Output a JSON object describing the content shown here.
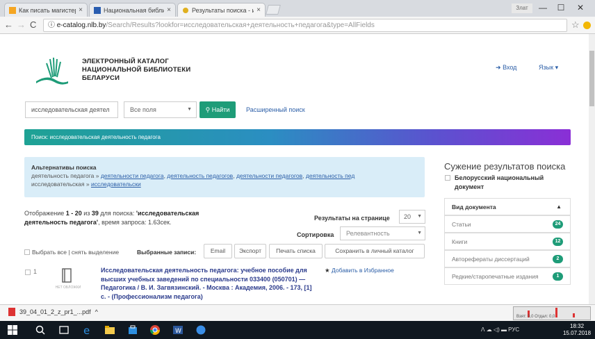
{
  "browser": {
    "tabs": [
      {
        "label": "Как писать магистерс",
        "close": "×"
      },
      {
        "label": "Национальная библиот",
        "close": "×"
      },
      {
        "label": "Результаты поиска - ис",
        "close": "×"
      }
    ],
    "user_label": "Злат",
    "window_controls": {
      "minimize": "—",
      "maximize": "☐",
      "close": "✕"
    },
    "nav": {
      "back": "←",
      "forward": "→",
      "reload": "C",
      "info": "ⓘ"
    },
    "url_host": "e-catalog.nlb.by",
    "url_path": "/Search/Results?lookfor=исследовательская+деятельность+педагога&type=AllFields",
    "bookmark_icon": "☆"
  },
  "header": {
    "brand_line1": "ЭЛЕКТРОННЫЙ КАТАЛОГ",
    "brand_line2": "НАЦИОНАЛЬНОЙ БИБЛИОТЕКИ",
    "brand_line3": "БЕЛАРУСИ",
    "login": "Вход",
    "language": "Язык"
  },
  "search": {
    "query": "исследовательская деятел",
    "field": "Все поля",
    "find_button": "Найти",
    "advanced_link": "Расширенный поиск"
  },
  "search_banner": "Поиск: исследовательская деятельность педагога",
  "alternatives": {
    "title": "Альтернативы поиска",
    "line1_prefix": "деятельность педагога » ",
    "links": [
      "деятельности педагога",
      "деятельность педагогов",
      "деятельности педагогов",
      "деятельность пед"
    ],
    "line2_prefix": "исследовательская » ",
    "link2": "исследовательски"
  },
  "results": {
    "info_prefix": "Отображение ",
    "range": "1 - 20",
    "of": " из ",
    "total": "39",
    "query_prefix": " для поиска: ",
    "query_text": "'исследовательская деятельность педагога'",
    "time": ", время запроса: 1.63сек.",
    "per_page_label": "Результаты на странице",
    "per_page_value": "20",
    "sort_label": "Сортировка",
    "sort_value": "Релевантность"
  },
  "toolbar": {
    "select_all": "Выбрать все | снять выделение",
    "selected_records": "Выбранные записи:",
    "buttons": [
      "Email",
      "Экспорт",
      "Печать списка",
      "Сохранить в личный каталог"
    ]
  },
  "result_item": {
    "number": "1",
    "book_caption": "НЕТ ОБЛОЖКИ",
    "title": "Исследовательская деятельность педагога: учебное пособие для высших учебных заведений по специальности 033400 (050701) — Педагогика / В. И. Загвязинский. - Москва : Академия, 2006. - 173, [1] с. - (Профессионализм педагога)",
    "add_favorites": "Добавить в Избранное"
  },
  "sidebar": {
    "title": "Сужение результатов поиска",
    "bnd_label": "Белорусский национальный документ",
    "facet_title": "Вид документа",
    "facets": [
      {
        "label": "Статьи",
        "count": "24"
      },
      {
        "label": "Книги",
        "count": "12"
      },
      {
        "label": "Авторефераты диссертаций",
        "count": "2"
      },
      {
        "label": "Редкие/старопечатные издания",
        "count": "1"
      }
    ]
  },
  "download": {
    "file": "39_04_01_2_z_pr1_...pdf",
    "thumb_caption": "Взят: 0,0 Отдал: 0,0"
  },
  "taskbar": {
    "tray": "ᐱ  ☁  ◁)  ▬  РУС",
    "time": "18:32",
    "date": "15.07.2018"
  },
  "colors": {
    "accent": "#1e9c78",
    "link": "#2b5ea7",
    "banner_start": "#1ea294",
    "banner_end": "#8a2fd6",
    "alt_bg": "#d9edf8"
  }
}
